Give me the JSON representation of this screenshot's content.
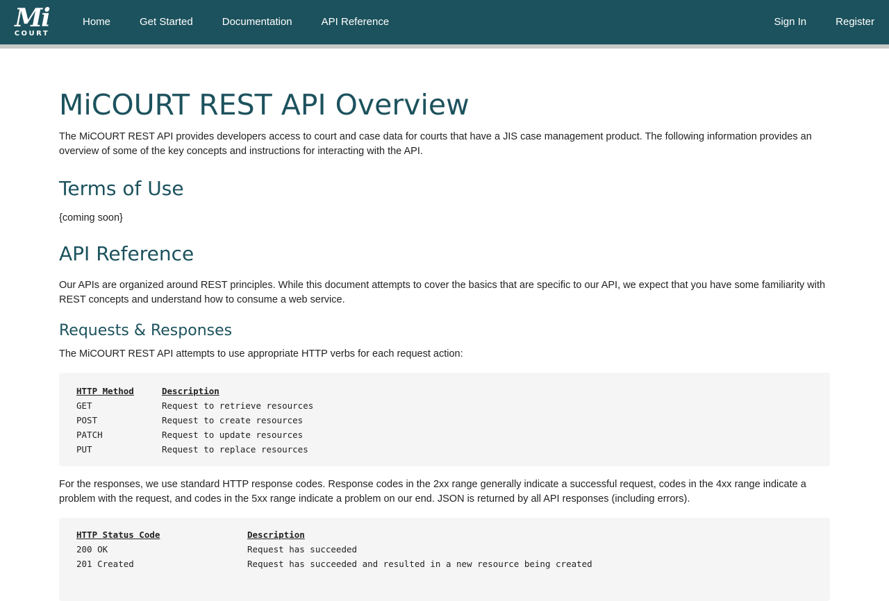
{
  "nav": {
    "logo_mi": "Mi",
    "logo_court": "COURT",
    "items": [
      "Home",
      "Get Started",
      "Documentation",
      "API Reference"
    ],
    "right": [
      "Sign In",
      "Register"
    ]
  },
  "page": {
    "title": "MiCOURT REST API Overview",
    "intro": "The MiCOURT REST API provides developers access to court and case data for courts that have a JIS case management product. The following information provides an overview of some of the key concepts and instructions for interacting with the API.",
    "terms_heading": "Terms of Use",
    "terms_text": "{coming soon}",
    "api_heading": "API Reference",
    "api_text": "Our APIs are organized around REST principles. While this document attempts to cover the basics that are specific to our API, we expect that you have some familiarity with REST concepts and understand how to consume a web service.",
    "req_heading": "Requests & Responses",
    "req_text": "The MiCOURT REST API attempts to use appropriate HTTP verbs for each request action:",
    "resp_text": "For the responses, we use standard HTTP response codes. Response codes in the 2xx range generally indicate a successful request, codes in the 4xx range indicate a problem with the request, and codes in the 5xx range indicate a problem on our end. JSON is returned by all API responses (including errors)."
  },
  "methods": {
    "header": [
      "HTTP Method",
      "Description"
    ],
    "rows": [
      [
        "GET",
        "Request to retrieve resources"
      ],
      [
        "POST",
        "Request to create resources"
      ],
      [
        "PATCH",
        "Request to update resources"
      ],
      [
        "PUT",
        "Request to replace resources"
      ]
    ]
  },
  "statuses": {
    "header": [
      "HTTP Status Code",
      "Description"
    ],
    "rows": [
      [
        "200 OK",
        "Request has succeeded"
      ],
      [
        "201 Created",
        "Request has succeeded and resulted in a new resource being created"
      ]
    ]
  }
}
